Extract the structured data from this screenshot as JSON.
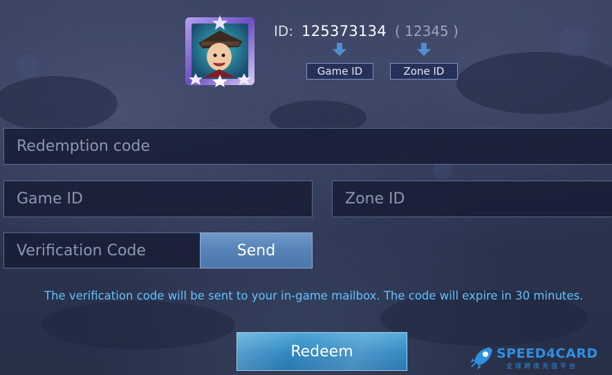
{
  "header": {
    "id_label": "ID:",
    "game_id_value": "125373134",
    "zone_id_value": "( 12345 )",
    "game_id_tag": "Game ID",
    "zone_id_tag": "Zone ID",
    "avatar_icon": "hero-avatar-icon"
  },
  "form": {
    "redemption_placeholder": "Redemption code",
    "game_id_placeholder": "Game ID",
    "zone_id_placeholder": "Zone ID",
    "verification_placeholder": "Verification Code",
    "send_label": "Send",
    "notice": "The verification code will be sent to your in-game mailbox. The code will expire in 30 minutes.",
    "redeem_label": "Redeem"
  },
  "watermark": {
    "brand": "SPEED4CARD",
    "tagline": "全球跨境充值平台"
  },
  "colors": {
    "background": "#2b3350",
    "field": "#181e36",
    "send": "#5682b6",
    "redeem": "#2f86c1",
    "notice": "#63c2ff",
    "arrow": "#4f8fd0"
  }
}
